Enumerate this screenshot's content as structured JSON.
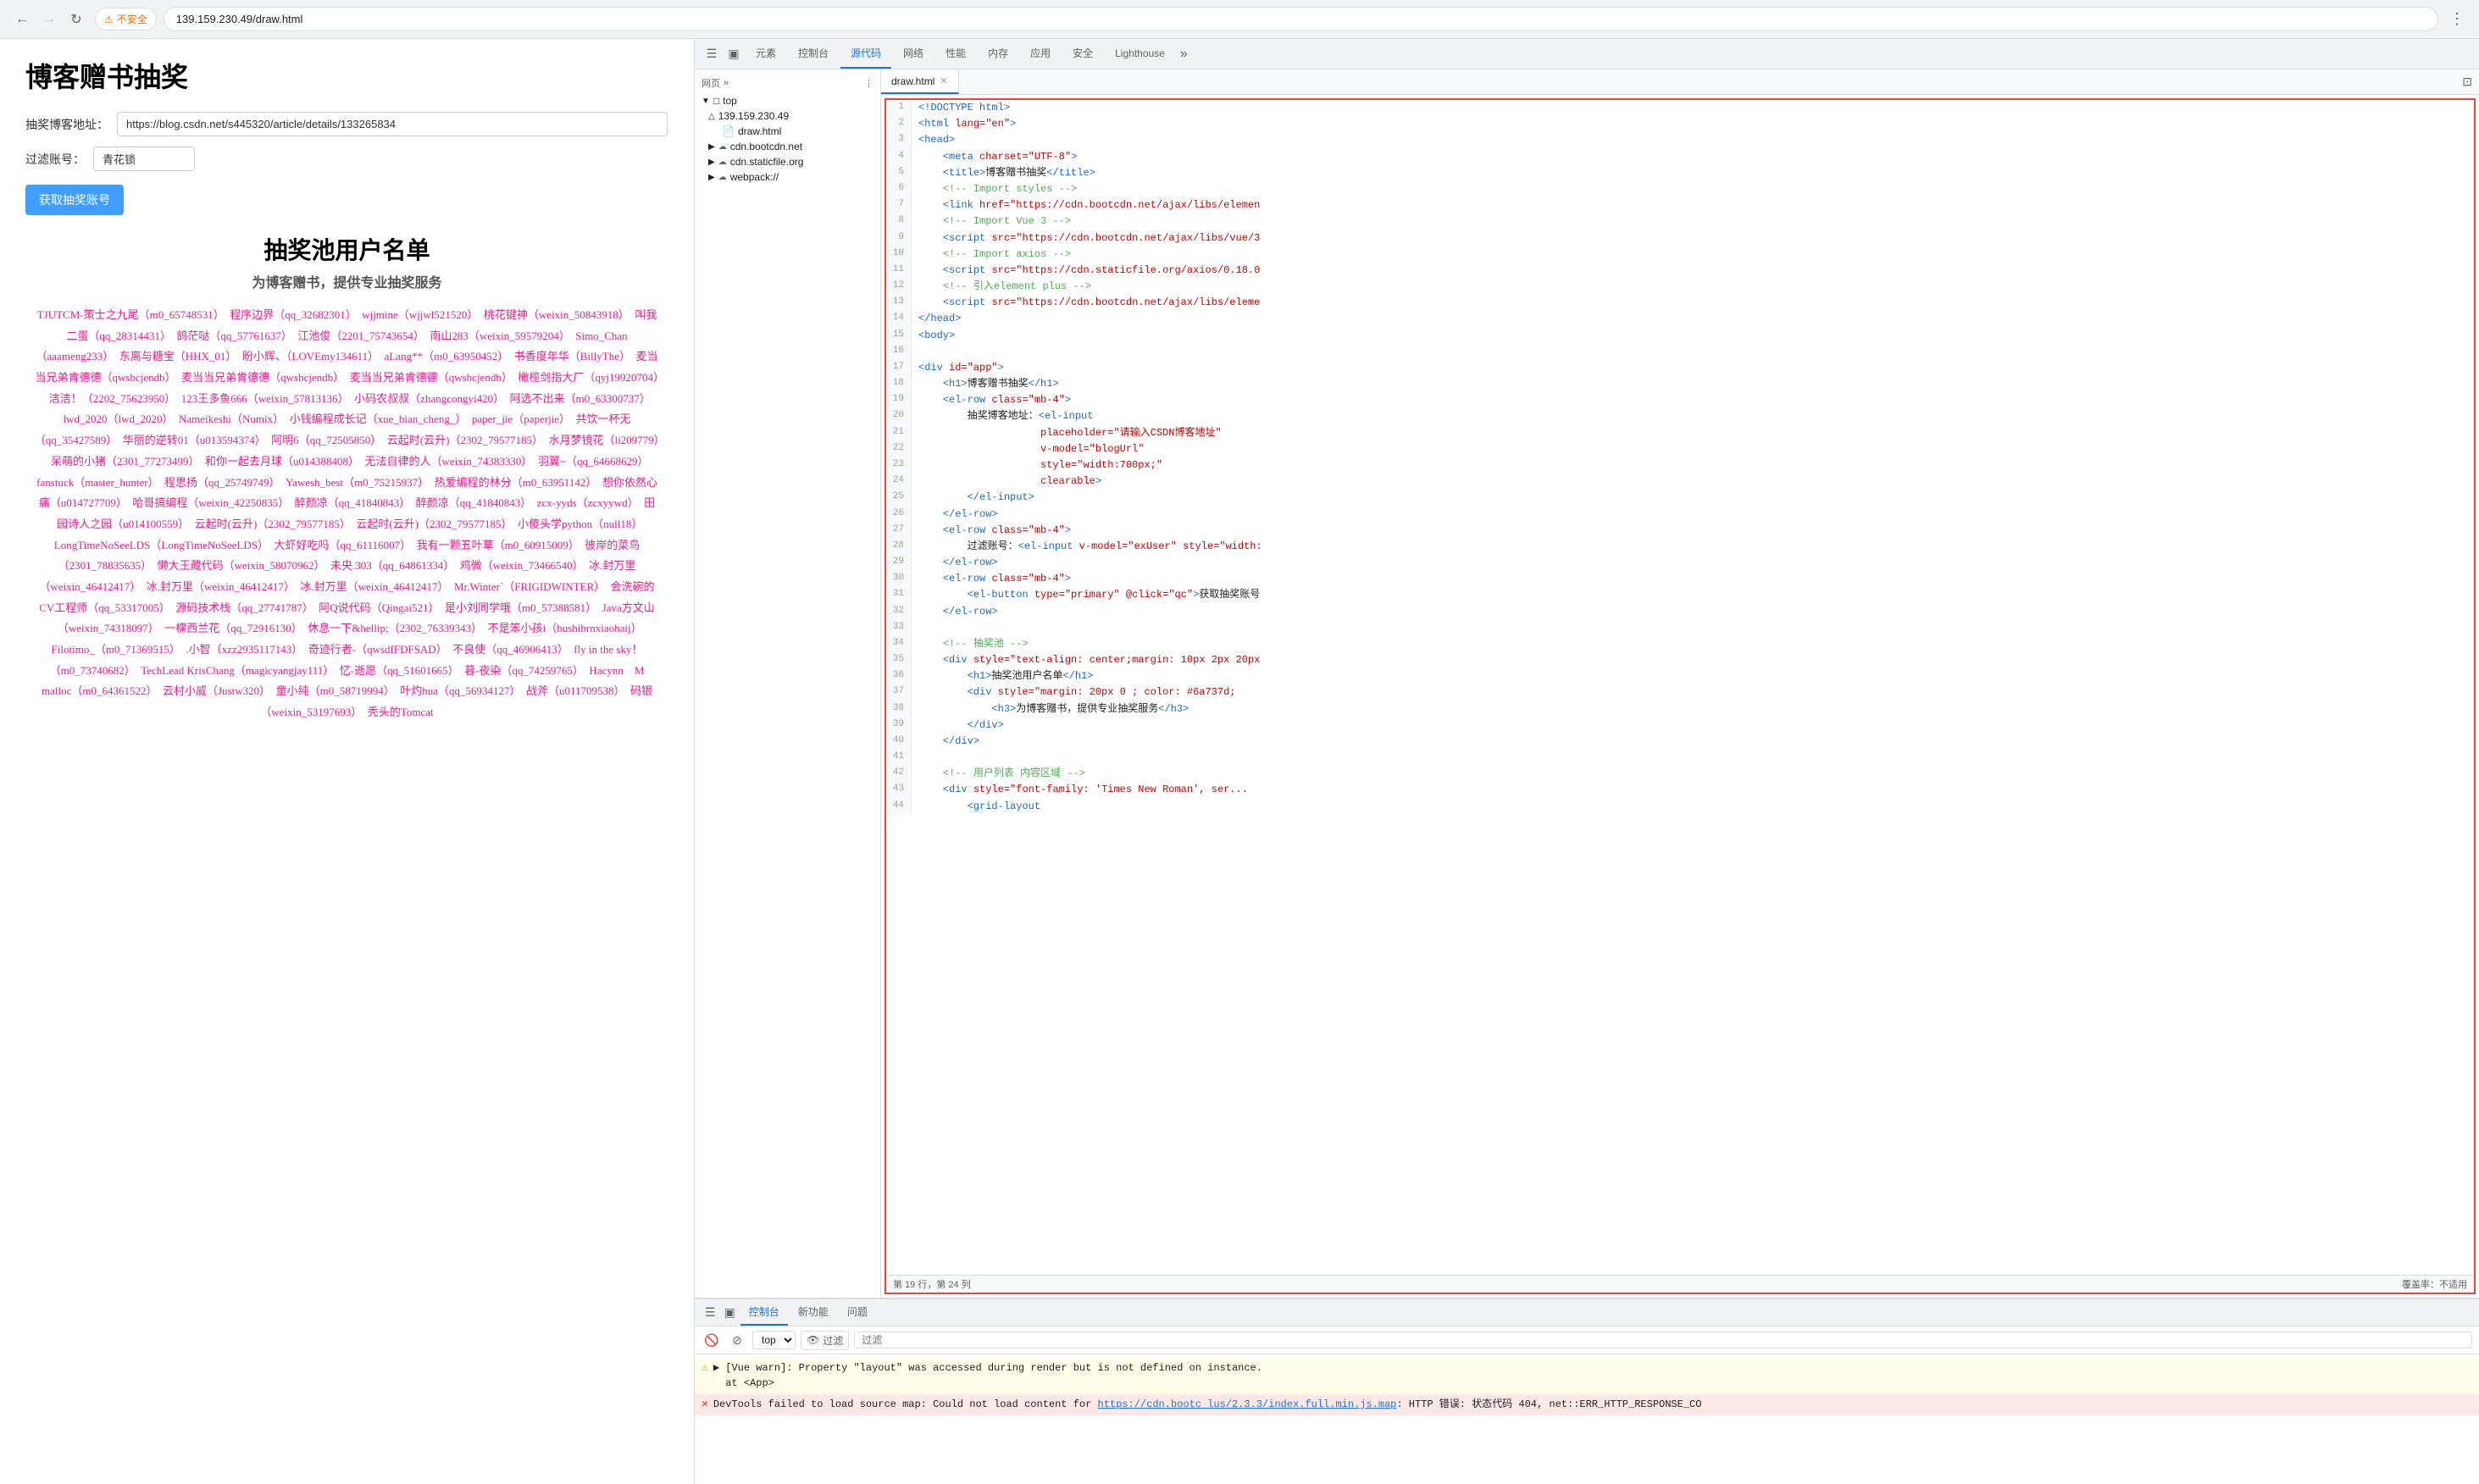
{
  "browser": {
    "url": "139.159.230.49/draw.html",
    "full_url": "https://139.159.230.49/draw.html",
    "security_label": "不安全",
    "back_disabled": false,
    "forward_disabled": true
  },
  "page": {
    "title": "博客赠书抽奖",
    "blog_url_label": "抽奖博客地址：",
    "blog_url_placeholder": "请输入CSDN博客地址",
    "blog_url_value": "https://blog.csdn.net/s445320/article/details/133265834",
    "filter_label": "过滤账号：",
    "filter_placeholder": "青花锁",
    "filter_value": "青花锁",
    "get_btn": "获取抽奖账号",
    "pool_title": "抽奖池用户名单",
    "pool_subtitle": "为博客赠书，提供专业抽奖服务",
    "users": "TJUTCM-策士之九尾（m0_65748531）　程序边界（qq_32682301）　wjjmine（wjjwl521520）　桃花键神（weixin_50843918）　叫我二蛋（qq_28314431）　鸽茫哒（qq_57761637）　江池俊（2201_75743654）　南山283（weixin_59579204）　Simo_Chan（aaameng233）　东离与糖宝（HHX_01）　盼小辉、（LOVEmy134611）　aLang**（m0_63950452）　书香度年华（BillyThe）　麦当当兄弟肯德德（qwsbcjendb）　麦当当兄弟肯德德（qwsbcjendb）　麦当当兄弟肯德德（qwsbcjendb）　橄榄剑指大厂（qyj19920704）　洁洁！（2202_75623950）　123王多鱼666（weixin_57813136）　小码农叔叔（zhangcongyi420）　阿选不出来（m0_63300737）　lwd_2020（lwd_2020）　Nameikeshi（Numix）　小钱编程成长记（xue_bian_cheng_）　paper_jie（paperjie）　共饮一杯无（qq_35427589）　华丽的逆转01（u013594374）　阿明6（qq_72505850）　云起时(云升)（2302_79577185）　水月梦镜花（li209779）　呆萌的小猪（2301_77273499）　和你一起去月球（u014388408）　无法自律的人（weixin_74383330）　羽翼~（qq_64668629）　fanstuck（master_hunter）　程思扬（qq_25749749）　Yawesh_best（m0_75215937）　热爱编程的林分（m0_63951142）　想你依然心痛（u014727709）　哈哥搞编程（weixin_42250835）　醉颜凉（qq_41840843）　醉颜凉（qq_41840843）　zcx-yyds（zcxyywd）　田园诗人之园（u014100559）　云起时(云升)（2302_79577185）　云起时(云升)（2302_79577185）　小傻头学python（null18）　LongTimeNoSeeLDS（LongTimeNoSeeLDS）　大虾好吃吗（qq_61116007）　我有一颗五叶草（m0_60915009）　彼岸的菜鸟（2301_78835635）　懒大王藏代码（weixin_58070962）　未央.303（qq_64861334）　鸡微（weixin_73466540）　冰.封万里（weixin_46412417）　冰.封万里（weixin_46412417）　冰.封万里（weixin_46412417）　Mr.Winter`（FRIGIDWINTER）　会洗碗的CV工程师（qq_53317005）　源码技术栈（qq_27741787）　阿Q说代码（Qingai521）　是小刘同学哦（m0_57388581）　Java方文山（weixin_74318097）　一棵西兰花（qq_72916130）　休息一下&hellip;（2302_76339343）　不是笨小孩i（bushibrnxiaohaij）　Filotimo_（m0_71369515）　.小智（xzz2935117143）　奇迹行者-（qwsdfFDFSAD）　不良使（qq_46906413）　fly in the sky！（m0_73740682）　TechLead KrisChang（magicyangjay111）　忆-逝愿（qq_51601665）　暮-夜染（qq_74259765）　Hacynn　M malloc（m0_64361522）　云村小威（Justw320）　童小纯（m0_58719994）　叶灼hua（qq_56934127）　战斧（u011709538）　码银（weixin_53197693）　秃头的Tomcat"
  },
  "devtools": {
    "tabs": [
      "☰",
      "□",
      "元素",
      "控制台",
      "源代码",
      "网络",
      "性能",
      "内存",
      "应用",
      "安全",
      "Lighthouse",
      "»"
    ],
    "elements_label": "元素",
    "console_label": "控制台",
    "sources_label": "源代码",
    "network_label": "网络",
    "performance_label": "性能",
    "memory_label": "内存",
    "application_label": "应用",
    "security_label": "安全",
    "lighthouse_label": "Lighthouse",
    "more_label": "»",
    "sidebar": {
      "header": "网页",
      "items": [
        {
          "label": "▼□ top",
          "indent": 0,
          "active": false
        },
        {
          "label": "△ 139.159.230.49",
          "indent": 1,
          "active": false
        },
        {
          "label": "draw.html",
          "indent": 2,
          "active": true
        },
        {
          "label": "⊕ cdn.bootcdn.net",
          "indent": 1,
          "active": false
        },
        {
          "label": "⊕ cdn.staticfile.org",
          "indent": 1,
          "active": false
        },
        {
          "label": "⊕ webpack://",
          "indent": 1,
          "active": false
        }
      ]
    },
    "source_file": "draw.html",
    "code_lines": [
      {
        "num": 1,
        "content": "<!DOCTYPE html>"
      },
      {
        "num": 2,
        "content": "<html lang=\"en\">"
      },
      {
        "num": 3,
        "content": "<head>"
      },
      {
        "num": 4,
        "content": "    <meta charset=\"UTF-8\">"
      },
      {
        "num": 5,
        "content": "    <title>博客赠书抽奖</title>"
      },
      {
        "num": 6,
        "content": "    <!-- Import styles -->"
      },
      {
        "num": 7,
        "content": "    <link href=\"https://cdn.bootcdn.net/ajax/libs/elemen"
      },
      {
        "num": 8,
        "content": "    <!-- Import Vue 3 -->"
      },
      {
        "num": 9,
        "content": "    <script src=\"https://cdn.bootcdn.net/ajax/libs/vue/3"
      },
      {
        "num": 10,
        "content": "    <!-- Import axios -->"
      },
      {
        "num": 11,
        "content": "    <script src=\"https://cdn.staticfile.org/axios/0.18.0"
      },
      {
        "num": 12,
        "content": "    <!-- 引入element plus -->"
      },
      {
        "num": 13,
        "content": "    <script src=\"https://cdn.bootcdn.net/ajax/libs/eleme"
      },
      {
        "num": 14,
        "content": "</head>"
      },
      {
        "num": 15,
        "content": "<body>"
      },
      {
        "num": 16,
        "content": ""
      },
      {
        "num": 17,
        "content": "<div id=\"app\">"
      },
      {
        "num": 18,
        "content": "    <h1>博客赠书抽奖</h1>"
      },
      {
        "num": 19,
        "content": "    <el-row class=\"mb-4\">"
      },
      {
        "num": 20,
        "content": "        抽奖博客地址：<el-input"
      },
      {
        "num": 21,
        "content": "                    placeholder=\"请输入CSDN博客地址\""
      },
      {
        "num": 22,
        "content": "                    v-model=\"blogUrl\""
      },
      {
        "num": 23,
        "content": "                    style=\"width:700px;\""
      },
      {
        "num": 24,
        "content": "                    clearable>"
      },
      {
        "num": 25,
        "content": "        </el-input>"
      },
      {
        "num": 26,
        "content": "    </el-row>"
      },
      {
        "num": 27,
        "content": "    <el-row class=\"mb-4\">"
      },
      {
        "num": 28,
        "content": "        过滤账号：<el-input v-model=\"exUser\" style=\"width:"
      },
      {
        "num": 29,
        "content": "    </el-row>"
      },
      {
        "num": 30,
        "content": "    <el-row class=\"mb-4\">"
      },
      {
        "num": 31,
        "content": "        <el-button type=\"primary\" @click=\"qc\">获取抽奖账号"
      },
      {
        "num": 32,
        "content": "    </el-row>"
      },
      {
        "num": 33,
        "content": ""
      },
      {
        "num": 34,
        "content": "    <!-- 抽奖池 -->"
      },
      {
        "num": 35,
        "content": "    <div style=\"text-align: center;margin: 10px 2px 20px"
      },
      {
        "num": 36,
        "content": "        <h1>抽奖池用户名单</h1>"
      },
      {
        "num": 37,
        "content": "        <div style=\"margin: 20px 0 ; color: #6a737d;"
      },
      {
        "num": 38,
        "content": "            <h3>为博客赠书，提供专业抽奖服务</h3>"
      },
      {
        "num": 39,
        "content": "        </div>"
      },
      {
        "num": 40,
        "content": "    </div>"
      },
      {
        "num": 41,
        "content": ""
      },
      {
        "num": 42,
        "content": "    <!-- 用户列表 内容区域 -->"
      },
      {
        "num": 43,
        "content": "    <div style=\"font-family: 'Times New Roman', ser..."
      },
      {
        "num": 44,
        "content": "        <grid-layout"
      }
    ],
    "status_line": "第 19 行，第 24 列",
    "coverage": "覆盖率：不适用"
  },
  "console": {
    "tabs": [
      "控制台",
      "新功能",
      "问题"
    ],
    "toolbar": {
      "top_value": "top",
      "filter_placeholder": "过滤",
      "eye_label": "过滤"
    },
    "messages": [
      {
        "type": "warning",
        "text": "[Vue warn]: Property \"layout\" was accessed during render but is not defined on instance.",
        "detail": "at <App>"
      },
      {
        "type": "error",
        "text": "DevTools failed to load source map: Could not load content for https://cdn.bootc lus/2.3.3/index.full.min.js.map: HTTP 错误: 状态代码 404, net::ERR_HTTP_RESPONSE_CO"
      }
    ]
  }
}
